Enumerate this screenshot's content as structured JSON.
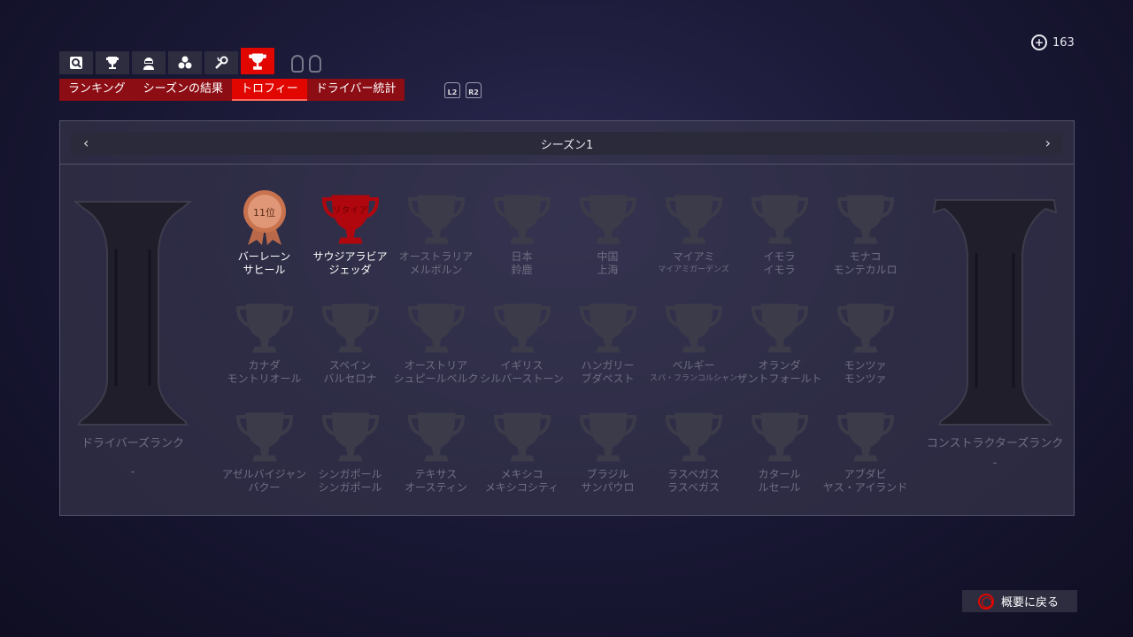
{
  "currency": {
    "icon": "plus-coin-icon",
    "value": "163"
  },
  "icon_tabs": [
    {
      "icon": "search-icon",
      "active": false
    },
    {
      "icon": "trophy-cup-icon",
      "active": false
    },
    {
      "icon": "driver-icon",
      "active": false
    },
    {
      "icon": "team-icon",
      "active": false
    },
    {
      "icon": "wrench-icon",
      "active": false
    },
    {
      "icon": "trophy-icon",
      "active": true
    }
  ],
  "tabs": [
    {
      "label": "ランキング",
      "active": false
    },
    {
      "label": "シーズンの結果",
      "active": false
    },
    {
      "label": "トロフィー",
      "active": true
    },
    {
      "label": "ドライバー統計",
      "active": false
    }
  ],
  "triggers": {
    "l2": "L2",
    "r2": "R2"
  },
  "season": {
    "label": "シーズン1"
  },
  "driver_rank": {
    "label": "ドライバーズランク",
    "value": "-"
  },
  "constructor_rank": {
    "label": "コンストラクターズランク",
    "value": "-"
  },
  "races": [
    {
      "line1": "バーレーン",
      "line2": "サヒール",
      "status": "bronze",
      "badge": "11位"
    },
    {
      "line1": "サウジアラビア",
      "line2": "ジェッダ",
      "status": "red",
      "badge": "リタイア"
    },
    {
      "line1": "オーストラリア",
      "line2": "メルボルン",
      "status": "locked"
    },
    {
      "line1": "日本",
      "line2": "鈴鹿",
      "status": "locked"
    },
    {
      "line1": "中国",
      "line2": "上海",
      "status": "locked"
    },
    {
      "line1": "マイアミ",
      "line2": "マイアミガーデンズ",
      "status": "locked",
      "small": true
    },
    {
      "line1": "イモラ",
      "line2": "イモラ",
      "status": "locked"
    },
    {
      "line1": "モナコ",
      "line2": "モンテカルロ",
      "status": "locked"
    },
    {
      "line1": "カナダ",
      "line2": "モントリオール",
      "status": "locked"
    },
    {
      "line1": "スペイン",
      "line2": "バルセロナ",
      "status": "locked"
    },
    {
      "line1": "オーストリア",
      "line2": "シュピールベルク",
      "status": "locked"
    },
    {
      "line1": "イギリス",
      "line2": "シルバーストーン",
      "status": "locked"
    },
    {
      "line1": "ハンガリー",
      "line2": "ブダペスト",
      "status": "locked"
    },
    {
      "line1": "ベルギー",
      "line2": "スパ・フランコルシャン",
      "status": "locked",
      "small": true
    },
    {
      "line1": "オランダ",
      "line2": "ザントフォールト",
      "status": "locked"
    },
    {
      "line1": "モンツァ",
      "line2": "モンツァ",
      "status": "locked"
    },
    {
      "line1": "アゼルバイジャン",
      "line2": "バクー",
      "status": "locked"
    },
    {
      "line1": "シンガポール",
      "line2": "シンガポール",
      "status": "locked"
    },
    {
      "line1": "テキサス",
      "line2": "オースティン",
      "status": "locked"
    },
    {
      "line1": "メキシコ",
      "line2": "メキシコシティ",
      "status": "locked"
    },
    {
      "line1": "ブラジル",
      "line2": "サンパウロ",
      "status": "locked"
    },
    {
      "line1": "ラスベガス",
      "line2": "ラスベガス",
      "status": "locked"
    },
    {
      "line1": "カタール",
      "line2": "ルセール",
      "status": "locked"
    },
    {
      "line1": "アブダビ",
      "line2": "ヤス・アイランド",
      "status": "locked"
    }
  ],
  "back_button": {
    "label": "概要に戻る",
    "icon": "circle-button-icon"
  },
  "colors": {
    "accent": "#e10600",
    "tab_bg": "#8c0d14",
    "bronze": "#c8724e",
    "locked": "#3c3b4a"
  }
}
